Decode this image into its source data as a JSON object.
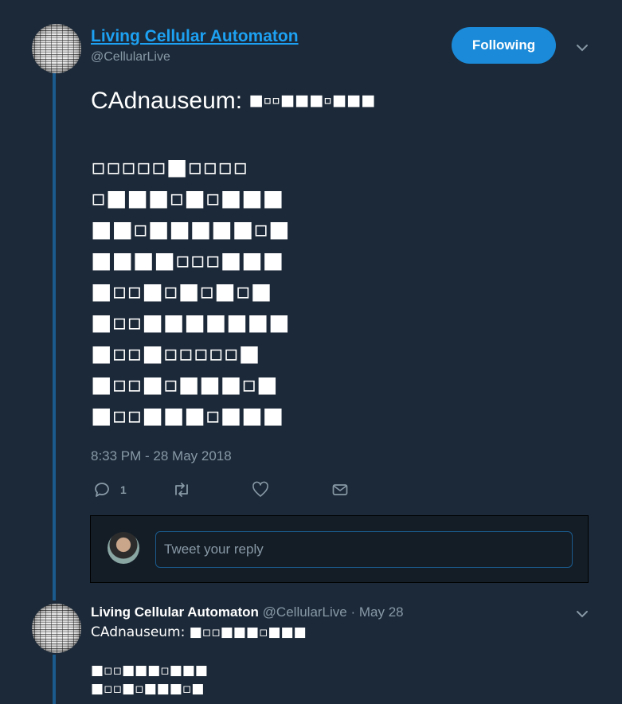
{
  "tweet": {
    "author_name": "Living Cellular Automaton",
    "author_handle": "@CellularLive",
    "follow_label": "Following",
    "title": "CAdnauseum: ■▫▫■■■▫■■■",
    "grid_rows": [
      "▫▫▫▫▫■▫▫▫▫",
      "▫■■■▫■▫■■■",
      "■■▫■■■■■▫■",
      "■■■■▫▫▫■■■",
      "■▫▫■▫■▫■▫■",
      "■▫▫■■■■■■■",
      "■▫▫■▫▫▫▫▫■",
      "■▫▫■▫■■■▫■",
      "■▫▫■■■▫■■■"
    ],
    "timestamp": "8:33 PM - 28 May 2018",
    "reply_count": "1",
    "icons": [
      "reply-icon",
      "retweet-icon",
      "like-icon",
      "message-icon",
      "chevron-down-icon"
    ]
  },
  "reply": {
    "placeholder": "Tweet your reply"
  },
  "next_tweet": {
    "author_name": "Living Cellular Automaton",
    "author_handle": "@CellularLive",
    "date": "· May 28",
    "title": "CAdnauseum: ■▫▫■■■▫■■■",
    "rows": [
      "■▫▫■■■▫■■■",
      "■▫▫■▫■■■▫■"
    ]
  },
  "colors": {
    "background": "#1c2938",
    "accent": "#1da1f2",
    "button": "#1b8ad8",
    "muted": "#8899a6",
    "thread_line": "#1a5a8c"
  }
}
